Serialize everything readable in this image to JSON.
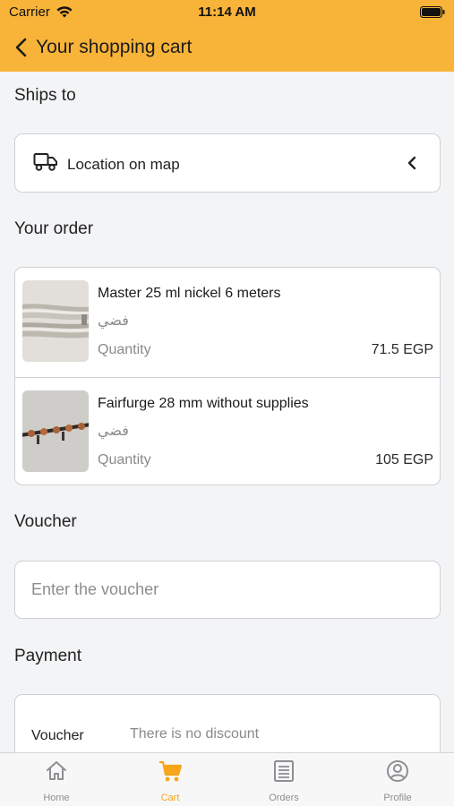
{
  "status_bar": {
    "carrier": "Carrier",
    "time": "11:14 AM"
  },
  "header": {
    "title": "Your shopping cart"
  },
  "ships_to": {
    "title": "Ships to",
    "location_label": "Location on map"
  },
  "order": {
    "title": "Your order",
    "items": [
      {
        "name": "Master 25 ml nickel 6 meters",
        "variant": "فضي",
        "quantity_label": "Quantity",
        "price": "71.5 EGP"
      },
      {
        "name": "Fairfurge 28 mm without supplies",
        "variant": "فضي",
        "quantity_label": "Quantity",
        "price": "105 EGP"
      }
    ]
  },
  "voucher": {
    "title": "Voucher",
    "placeholder": "Enter the voucher",
    "value": ""
  },
  "payment": {
    "title": "Payment",
    "voucher_label": "Voucher",
    "voucher_value": "There is no discount"
  },
  "tabbar": {
    "tabs": [
      {
        "label": "Home",
        "icon": "home-icon",
        "active": false
      },
      {
        "label": "Cart",
        "icon": "cart-icon",
        "active": true
      },
      {
        "label": "Orders",
        "icon": "orders-icon",
        "active": false
      },
      {
        "label": "Profile",
        "icon": "profile-icon",
        "active": false
      }
    ]
  },
  "colors": {
    "header": "#f8b339",
    "active_tab": "#f7a51a",
    "inactive_tab": "#8e8e93"
  }
}
